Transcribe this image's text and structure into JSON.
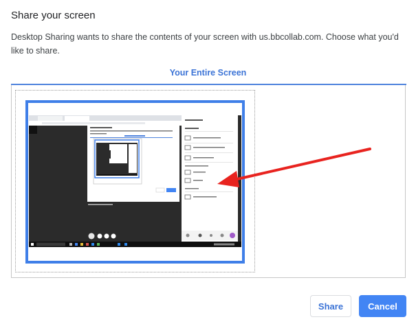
{
  "dialog": {
    "title": "Share your screen",
    "description": "Desktop Sharing wants to share the contents of your screen with us.bbcollab.com. Choose what you'd like to share."
  },
  "tabs": [
    {
      "label": "Your Entire Screen",
      "selected": true
    }
  ],
  "buttons": {
    "share_label": "Share",
    "cancel_label": "Cancel"
  },
  "colors": {
    "accent": "#4285f4",
    "tab_text": "#3b73d6",
    "annotation_arrow": "#e8231f"
  },
  "icons": {
    "annotation": "red-arrow"
  }
}
